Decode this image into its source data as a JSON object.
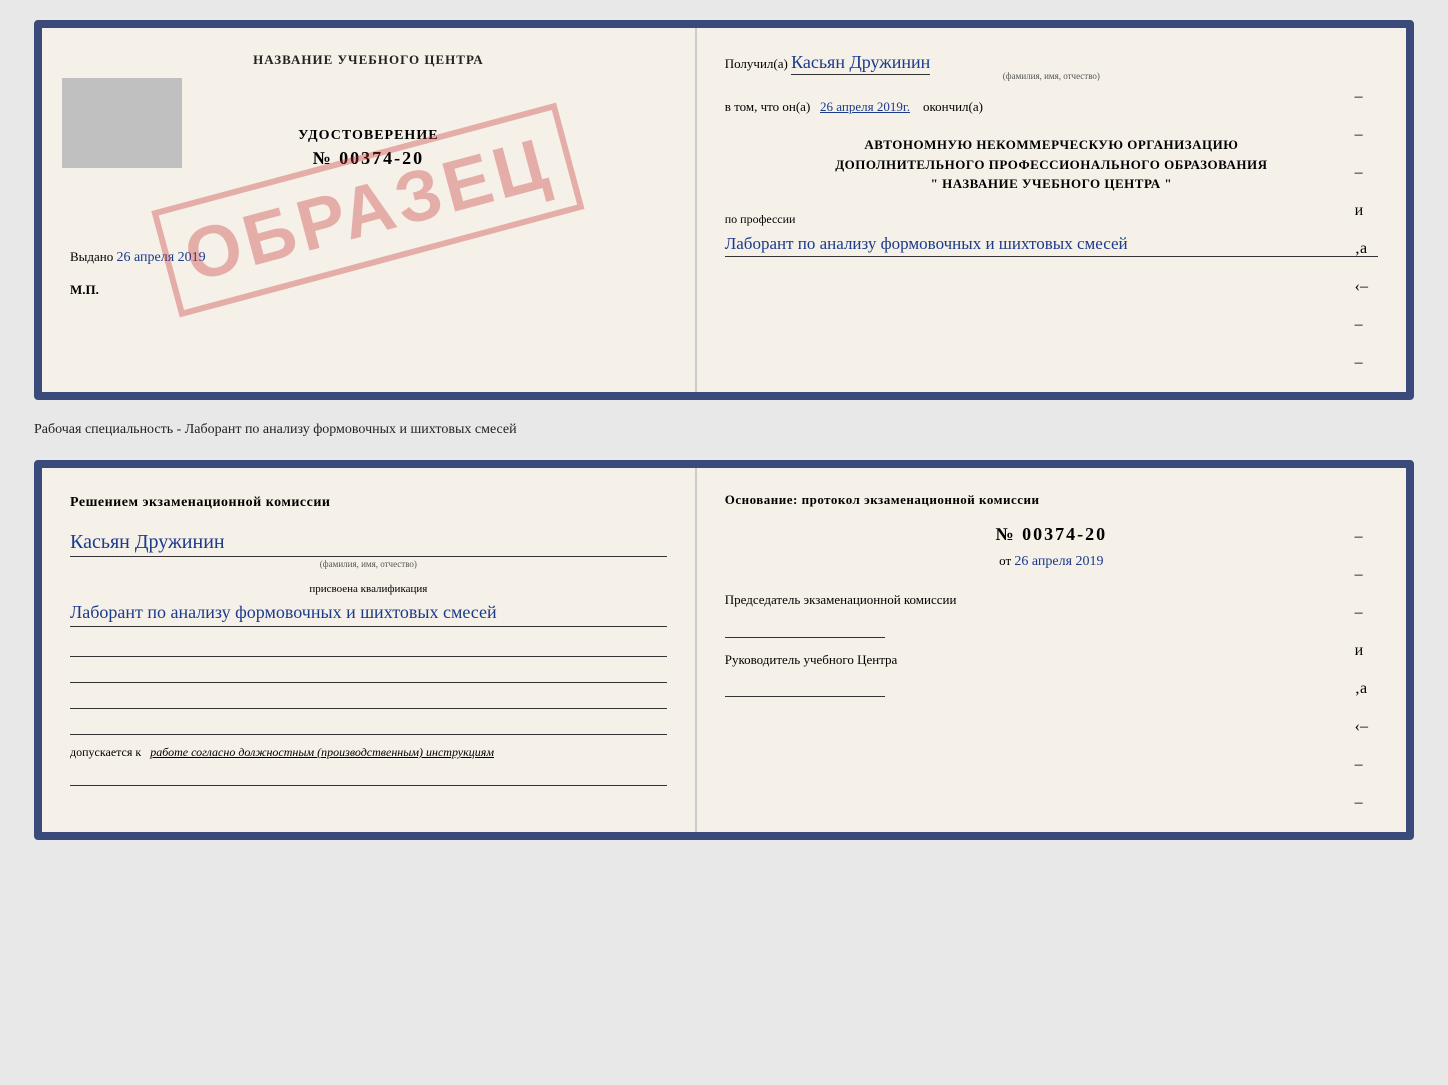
{
  "page": {
    "background": "#e8e8e8"
  },
  "topCert": {
    "left": {
      "title": "НАЗВАНИЕ УЧЕБНОГО ЦЕНТРА",
      "stamp": "ОБРАЗЕЦ",
      "udostovLabel": "УДОСТОВЕРЕНИЕ",
      "udostovNum": "№ 00374-20",
      "vydanoLabel": "Выдано",
      "vydanoDate": "26 апреля 2019",
      "mpLabel": "М.П."
    },
    "right": {
      "poluchilLabel": "Получил(а)",
      "poluchilValue": "Касьян Дружинин",
      "poluchilSubLabel": "(фамилия, имя, отчество)",
      "vtomLabel": "в том, что он(а)",
      "vtomDate": "26 апреля 2019г.",
      "okonchilLabel": "окончил(а)",
      "orgLine1": "АВТОНОМНУЮ НЕКОММЕРЧЕСКУЮ ОРГАНИЗАЦИЮ",
      "orgLine2": "ДОПОЛНИТЕЛЬНОГО ПРОФЕССИОНАЛЬНОГО ОБРАЗОВАНИЯ",
      "orgLine3": "\"  НАЗВАНИЕ УЧЕБНОГО ЦЕНТРА  \"",
      "poProfLabel": "по профессии",
      "poProfValue": "Лаборант по анализу формовочных и шихтовых смесей",
      "dashes": [
        "–",
        "–",
        "–",
        "и",
        "‚а",
        "‹–",
        "–",
        "–"
      ]
    }
  },
  "betweenLabel": "Рабочая специальность - Лаборант по анализу формовочных и шихтовых смесей",
  "bottomCert": {
    "left": {
      "heading": "Решением экзаменационной комиссии",
      "kasyanValue": "Касьян Дружинин",
      "fioSmall": "(фамилия, имя, отчество)",
      "prisvoenaLabel": "присвоена квалификация",
      "kvalifValue": "Лаборант по анализу формовочных и шихтовых смесей",
      "dopuskaetsyaLabel": "допускается к",
      "dopuskaetsyaValue": "работе согласно должностным (производственным) инструкциям"
    },
    "right": {
      "osnovaniHeading": "Основание: протокол экзаменационной комиссии",
      "protocolNum": "№ 00374-20",
      "otLabel": "от",
      "otDate": "26 апреля 2019",
      "chairmanLabel": "Председатель экзаменационной комиссии",
      "rukLabel": "Руководитель учебного Центра",
      "dashes": [
        "–",
        "–",
        "–",
        "и",
        "‚а",
        "‹–",
        "–",
        "–"
      ]
    }
  }
}
